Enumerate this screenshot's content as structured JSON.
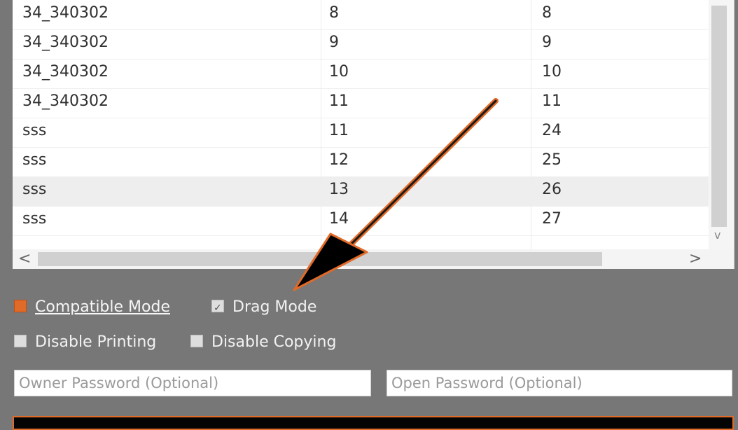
{
  "table": {
    "rows": [
      {
        "name": "34_340302",
        "a": "8",
        "b": "8",
        "highlight": false
      },
      {
        "name": "34_340302",
        "a": "9",
        "b": "9",
        "highlight": false
      },
      {
        "name": "34_340302",
        "a": "10",
        "b": "10",
        "highlight": false
      },
      {
        "name": "34_340302",
        "a": "11",
        "b": "11",
        "highlight": false
      },
      {
        "name": "sss",
        "a": "11",
        "b": "24",
        "highlight": false
      },
      {
        "name": "sss",
        "a": "12",
        "b": "25",
        "highlight": false
      },
      {
        "name": "sss",
        "a": "13",
        "b": "26",
        "highlight": true
      },
      {
        "name": "sss",
        "a": "14",
        "b": "27",
        "highlight": false
      }
    ]
  },
  "scroll": {
    "left_arrow": "<",
    "right_arrow": ">",
    "down_arrow": "v"
  },
  "options": {
    "compatible_mode": "Compatible Mode",
    "drag_mode": "Drag Mode",
    "disable_printing": "Disable Printing",
    "disable_copying": "Disable Copying"
  },
  "passwords": {
    "owner_placeholder": "Owner Password (Optional)",
    "open_placeholder": "Open Password (Optional)"
  },
  "colors": {
    "accent": "#e06a28",
    "background": "#777777"
  }
}
